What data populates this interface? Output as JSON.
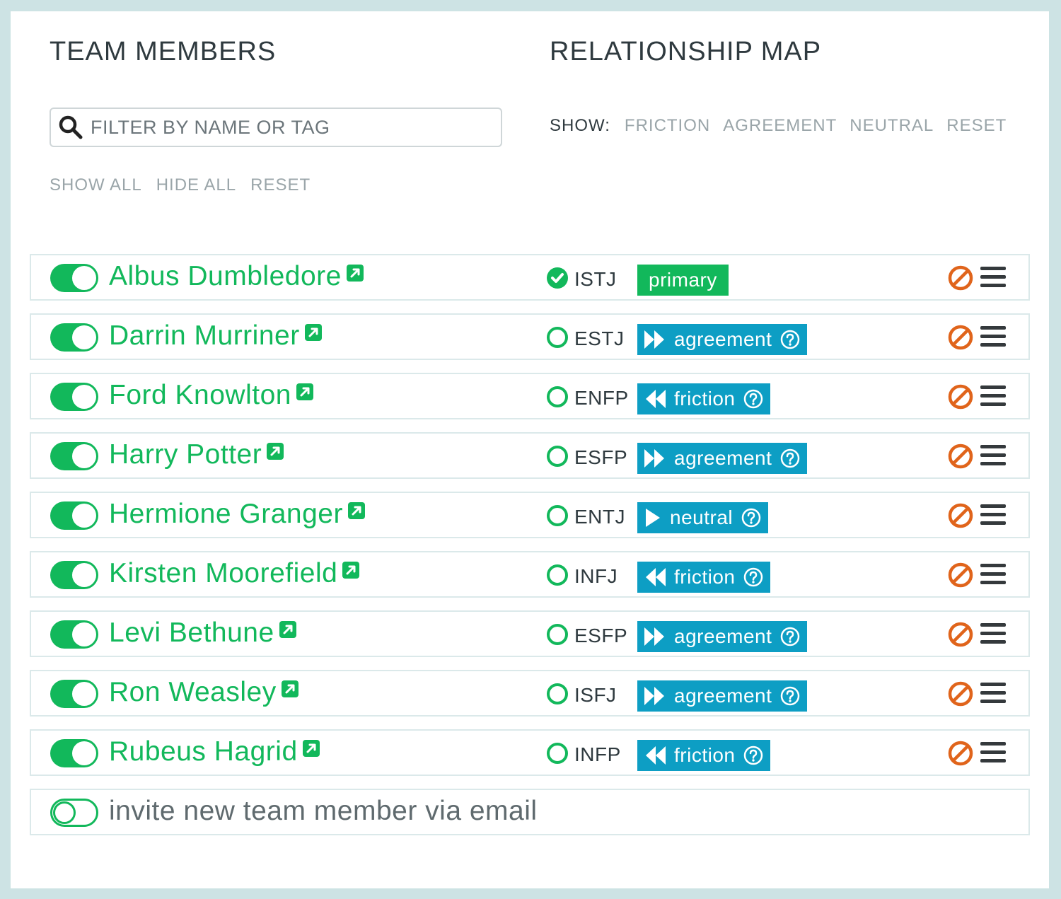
{
  "team_members": {
    "title": "TEAM MEMBERS",
    "filter_placeholder": "FILTER BY NAME OR TAG",
    "actions": [
      "SHOW ALL",
      "HIDE ALL",
      "RESET"
    ]
  },
  "relationship_map": {
    "title": "RELATIONSHIP MAP",
    "show_label": "SHOW:",
    "filters": [
      "FRICTION",
      "AGREEMENT",
      "NEUTRAL",
      "RESET"
    ]
  },
  "members": [
    {
      "name": "Albus Dumbledore",
      "mbti": "ISTJ",
      "relation": "primary",
      "selected": true
    },
    {
      "name": "Darrin Murriner",
      "mbti": "ESTJ",
      "relation": "agreement",
      "selected": false
    },
    {
      "name": "Ford Knowlton",
      "mbti": "ENFP",
      "relation": "friction",
      "selected": false
    },
    {
      "name": "Harry Potter",
      "mbti": "ESFP",
      "relation": "agreement",
      "selected": false
    },
    {
      "name": "Hermione Granger",
      "mbti": "ENTJ",
      "relation": "neutral",
      "selected": false
    },
    {
      "name": "Kirsten Moorefield",
      "mbti": "INFJ",
      "relation": "friction",
      "selected": false
    },
    {
      "name": "Levi Bethune",
      "mbti": "ESFP",
      "relation": "agreement",
      "selected": false
    },
    {
      "name": "Ron Weasley",
      "mbti": "ISFJ",
      "relation": "agreement",
      "selected": false
    },
    {
      "name": "Rubeus Hagrid",
      "mbti": "INFP",
      "relation": "friction",
      "selected": false
    }
  ],
  "invite": {
    "label": "invite new team member via email"
  },
  "colors": {
    "green": "#12b85b",
    "blue": "#0d9ec4",
    "orange": "#e0641b",
    "dark": "#2f3a3f"
  },
  "icons": {
    "search": "search-icon",
    "external": "external-link-icon",
    "ban": "ban-icon",
    "menu": "menu-icon",
    "help": "help-icon"
  }
}
